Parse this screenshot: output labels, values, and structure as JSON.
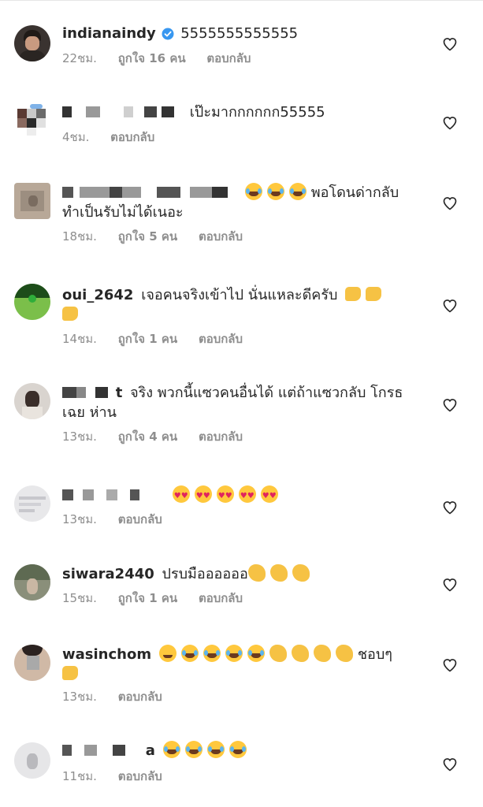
{
  "comments": [
    {
      "user": "indianaindy",
      "verified": true,
      "text": "5555555555555",
      "time": "22ชม.",
      "likes": "ถูกใจ 16 คน",
      "reply": "ตอบกลับ"
    },
    {
      "user": "",
      "text": "เป๊ะมากกกกกก55555",
      "time": "4ชม.",
      "likes": "",
      "reply": "ตอบกลับ"
    },
    {
      "user": "",
      "text": "พอโดนด่ากลับ",
      "text2": "ทำเป็นรับไม่ได้เนอะ",
      "time": "18ชม.",
      "likes": "ถูกใจ 5 คน",
      "reply": "ตอบกลับ",
      "emojis": [
        "laugh",
        "laugh",
        "laugh"
      ]
    },
    {
      "user": "oui_2642",
      "text": "เจอคนจริงเข้าไป นั่นแหละดีครับ",
      "time": "14ชม.",
      "likes": "ถูกใจ 1 คน",
      "reply": "ตอบกลับ"
    },
    {
      "user": "t",
      "text": "จริง พวกนี้แซวคนอื่นได้ แต่ถ้าแซวกลับ โกรธ",
      "text2": "เฉย ห่าน",
      "time": "13ชม.",
      "likes": "ถูกใจ 4 คน",
      "reply": "ตอบกลับ"
    },
    {
      "user": "",
      "text": "",
      "time": "13ชม.",
      "likes": "",
      "reply": "ตอบกลับ",
      "emojis": [
        "heart-eyes",
        "heart-eyes",
        "heart-eyes",
        "heart-eyes",
        "heart-eyes"
      ]
    },
    {
      "user": "siwara2440",
      "text": "ปรบมืออออออ",
      "time": "15ชม.",
      "likes": "ถูกใจ 1 คน",
      "reply": "ตอบกลับ"
    },
    {
      "user": "wasinchom",
      "text": "ชอบๆ",
      "time": "13ชม.",
      "likes": "",
      "reply": "ตอบกลับ"
    },
    {
      "user": "a",
      "text": "",
      "time": "11ชม.",
      "likes": "",
      "reply": "ตอบกลับ"
    }
  ],
  "icons": {
    "heart": "heart-outline-icon",
    "verified": "verified-badge-icon"
  },
  "colors": {
    "text": "#262626",
    "meta": "#8e8e8e",
    "verified": "#3897f0"
  }
}
